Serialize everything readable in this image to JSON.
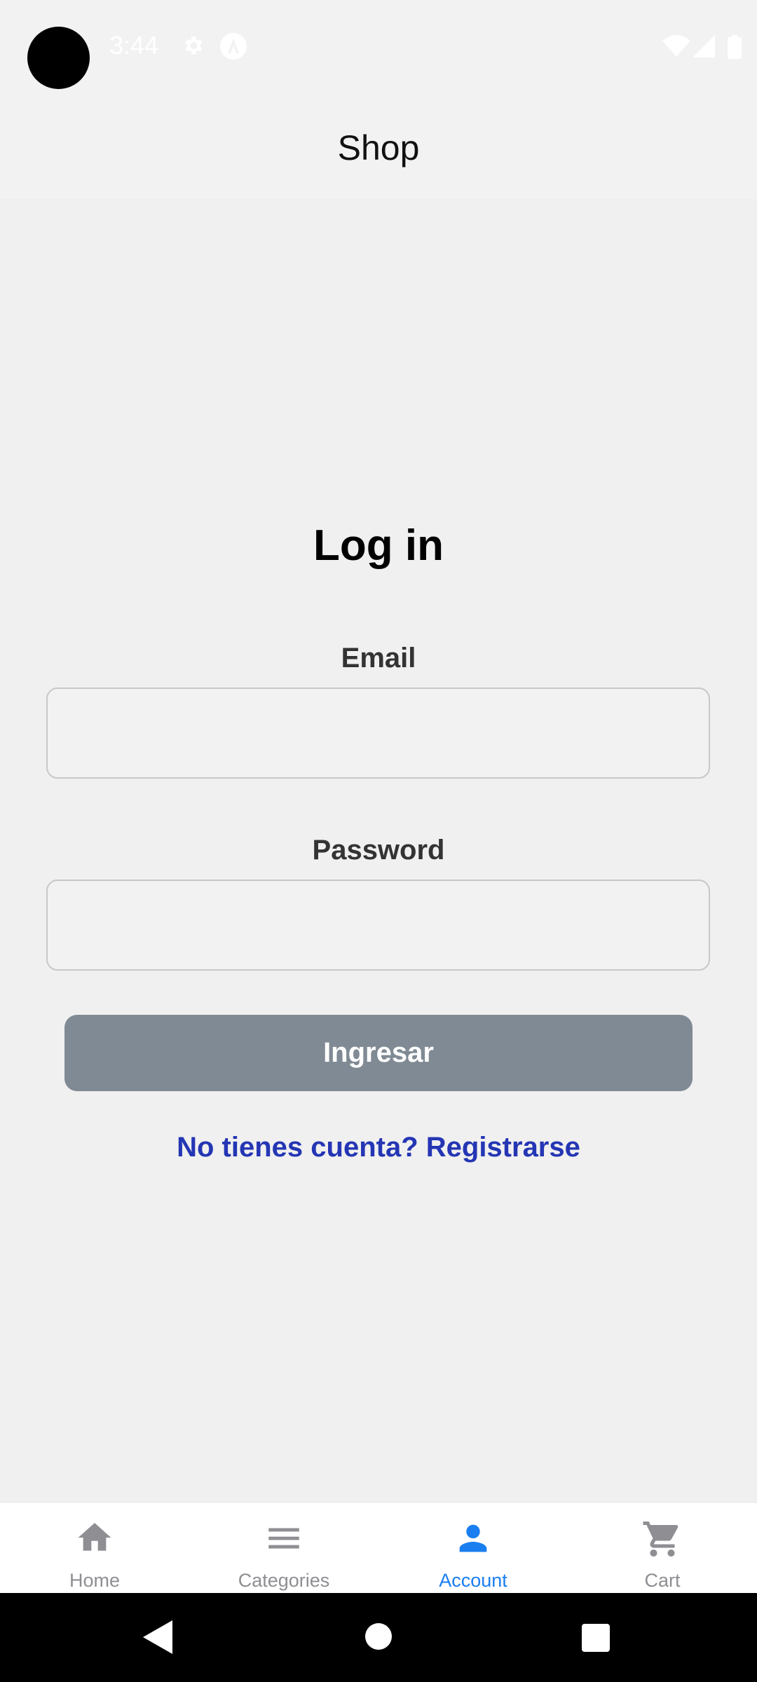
{
  "status_bar": {
    "time": "3:44",
    "icons": [
      "settings-icon",
      "app-badge-icon",
      "wifi-icon",
      "signal-icon",
      "battery-icon"
    ]
  },
  "header": {
    "title": "Shop"
  },
  "login": {
    "title": "Log in",
    "email_label": "Email",
    "email_value": "",
    "password_label": "Password",
    "password_value": "",
    "submit_label": "Ingresar",
    "register_link": "No tienes cuenta? Registrarse"
  },
  "tabbar": {
    "items": [
      {
        "label": "Home",
        "icon": "home-icon",
        "active": false
      },
      {
        "label": "Categories",
        "icon": "menu-icon",
        "active": false
      },
      {
        "label": "Account",
        "icon": "person-icon",
        "active": true
      },
      {
        "label": "Cart",
        "icon": "cart-icon",
        "active": false
      }
    ]
  },
  "colors": {
    "background": "#f2f2f2",
    "button": "#808a94",
    "link": "#2436b4",
    "active_tab": "#1a7ef0",
    "inactive_tab": "#8e8e93"
  }
}
